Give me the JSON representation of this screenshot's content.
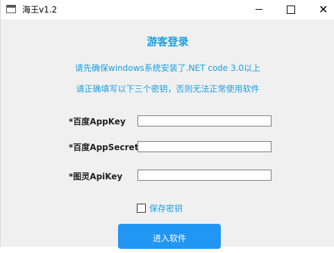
{
  "window": {
    "title": "海王v1.2"
  },
  "titlebar": {
    "icons": {
      "app": "window-icon",
      "minimize": "minimize-icon",
      "maximize": "maximize-icon",
      "close": "close-icon"
    },
    "close_glyph": "✕"
  },
  "main": {
    "heading": "游客登录",
    "notice_line1": "请先确保windows系统安装了.NET code 3.0以上",
    "notice_line2": "请正确填写以下三个密钥，否则无法正常使用软件"
  },
  "form": {
    "fields": [
      {
        "label": "*百度AppKey",
        "value": ""
      },
      {
        "label": "*百度AppSecret",
        "value": ""
      },
      {
        "label": "*图灵ApiKey",
        "value": ""
      }
    ],
    "save_key_label": "保存密钥",
    "save_key_checked": false,
    "enter_button": "进入软件"
  },
  "colors": {
    "accent": "#1a9fe0",
    "button": "#2196f3",
    "background": "#f0f0f0"
  }
}
